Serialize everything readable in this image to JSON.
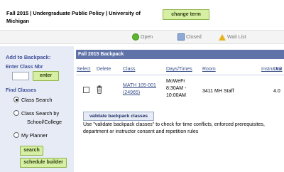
{
  "header": {
    "term_title": "Fall 2015 | Undergraduate Public Policy | University of Michigan",
    "change_term_label": "change term"
  },
  "legend": {
    "open": "Open",
    "closed": "Closed",
    "wait_list": "Wait List",
    "colors": {
      "open": "#5bb82e",
      "closed": "#8ea9d6",
      "wait_list": "#e8b21a"
    }
  },
  "sidebar": {
    "add_title": "Add to Backpack:",
    "enter_class_label": "Enter Class Nbr",
    "class_nbr_value": "",
    "enter_button": "enter",
    "find_title": "Find Classes",
    "options": [
      {
        "label": "Class Search",
        "selected": true
      },
      {
        "label": "Class Search by",
        "label_line2": "School/College",
        "selected": false
      },
      {
        "label": "My Planner",
        "selected": false
      }
    ],
    "search_button": "search",
    "schedule_builder_button": "schedule builder"
  },
  "backpack": {
    "title": "Fall 2015 Backpack",
    "columns": {
      "select": "Select",
      "delete": "Delete",
      "class": "Class",
      "days_times": "Days/Times",
      "room": "Room",
      "instructor": "Instructor",
      "units": "Unit"
    },
    "rows": [
      {
        "class_line1": "MATH 105-001",
        "class_line2": "(24965)",
        "days": "MoWeFr",
        "time_line1": "8:30AM -",
        "time_line2": "10:00AM",
        "room": "3411 MH",
        "instructor": "Staff",
        "units": "4.0",
        "selected": false
      }
    ],
    "validate_button": "validate backpack classes",
    "validate_note": "Use \"validate backpack classes\" to check for time conflicts, enforced prerequisites, department or instructor consent and repetition rules"
  },
  "icons": [
    "open-status-icon",
    "closed-status-icon",
    "wait-list-icon",
    "trash-icon"
  ]
}
